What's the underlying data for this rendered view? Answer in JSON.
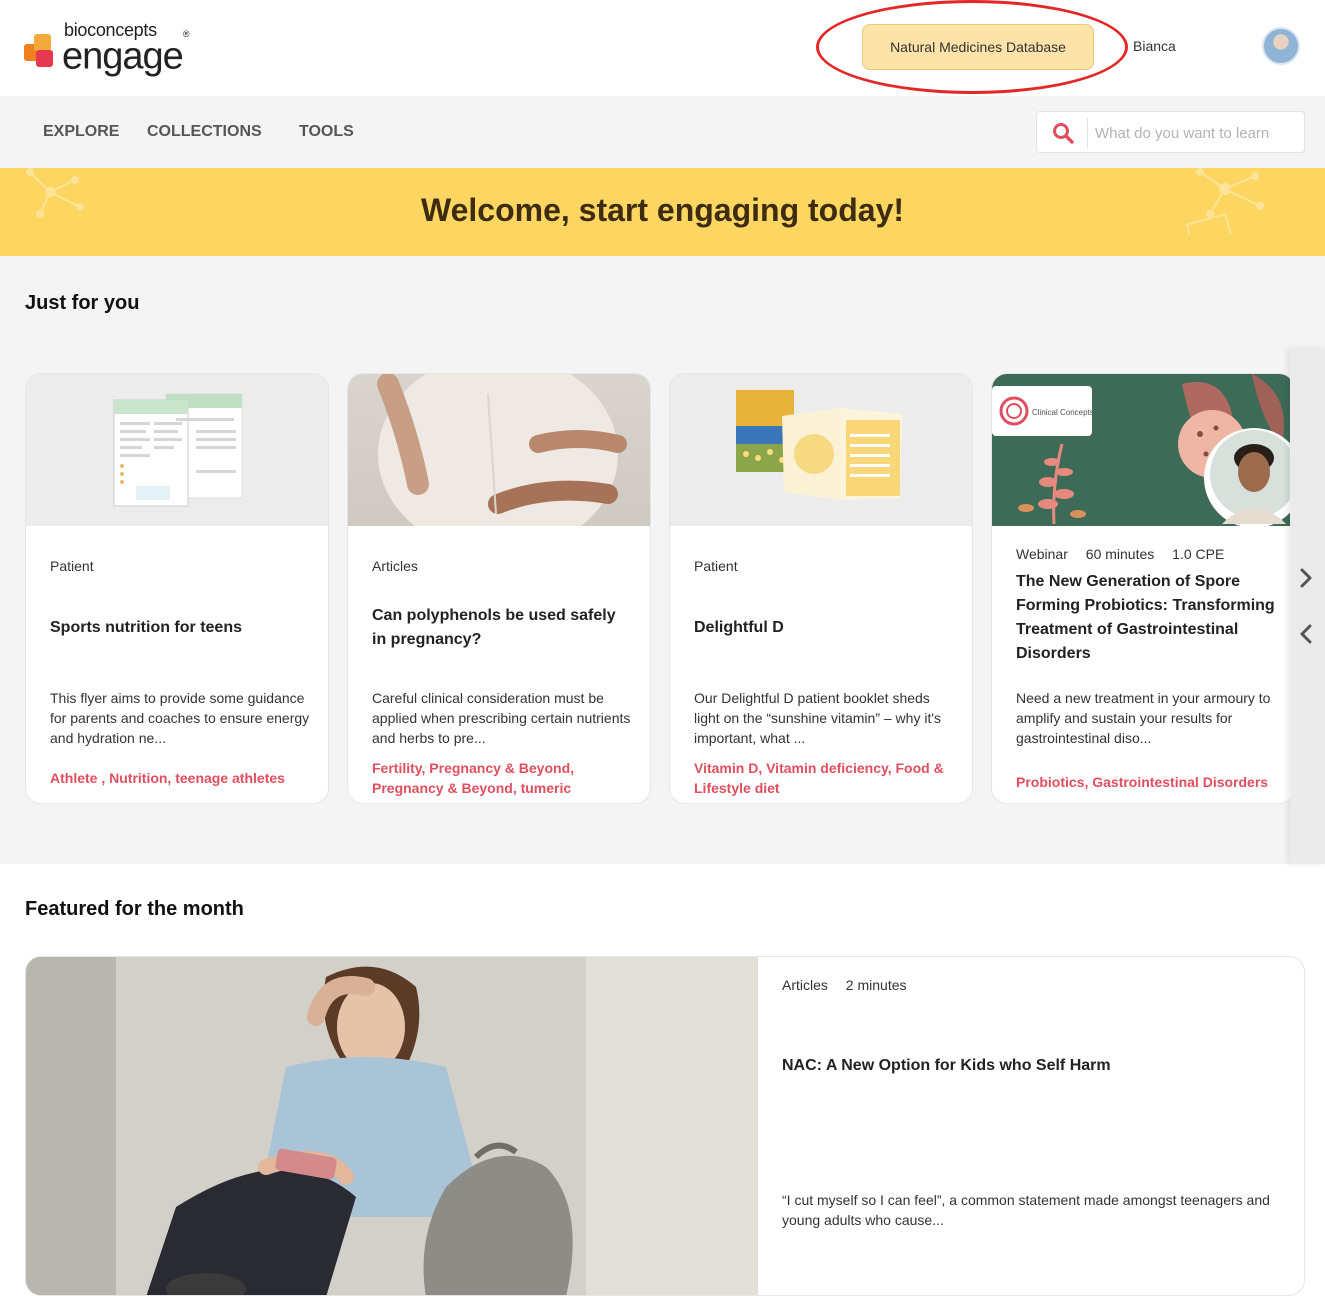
{
  "header": {
    "logo_small": "bioconcepts",
    "logo_big": "engage",
    "logo_mark": "®",
    "nmd_button": "Natural Medicines Database",
    "username": "Bianca"
  },
  "nav": {
    "items": [
      "EXPLORE",
      "COLLECTIONS",
      "TOOLS"
    ],
    "search_placeholder": "What do you want to learn"
  },
  "banner": {
    "title": "Welcome, start engaging today!"
  },
  "just_for_you": {
    "title": "Just for you",
    "cards": [
      {
        "meta": [
          "Patient"
        ],
        "title": "Sports nutrition for teens",
        "description": "This flyer aims to provide some guidance for parents and coaches to ensure energy and hydration ne...",
        "tags": "Athlete , Nutrition, teenage athletes"
      },
      {
        "meta": [
          "Articles"
        ],
        "title": "Can polyphenols be used safely in pregnancy?",
        "description": "Careful clinical consideration must be applied when prescribing certain nutrients and herbs to pre...",
        "tags": "Fertility, Pregnancy & Beyond, Pregnancy & Beyond, tumeric"
      },
      {
        "meta": [
          "Patient"
        ],
        "title": "Delightful D",
        "description": "Our Delightful D patient booklet sheds light on the “sunshine vitamin” – why it's important, what ...",
        "tags": "Vitamin D, Vitamin deficiency, Food & Lifestyle diet"
      },
      {
        "meta": [
          "Webinar",
          "60 minutes",
          "1.0 CPE"
        ],
        "title": "The New Generation of Spore Forming Probiotics: Transforming Treatment of Gastrointestinal Disorders",
        "description": "Need a new treatment in your armoury to amplify and sustain your results for gastrointestinal diso...",
        "tags": "Probiotics, Gastrointestinal Disorders",
        "image_logo": "Clinical Concepts"
      }
    ]
  },
  "featured": {
    "title": "Featured for the month",
    "meta": [
      "Articles",
      "2 minutes"
    ],
    "headline": "NAC: A New Option for Kids who Self Harm",
    "description": "“I cut myself so I can feel”, a common statement made amongst teenagers and young adults who cause..."
  },
  "colors": {
    "accent_tag": "#e04f5f",
    "banner": "#fdd561",
    "nmd_button": "#fde3a7",
    "highlight_ring": "#e32626"
  }
}
